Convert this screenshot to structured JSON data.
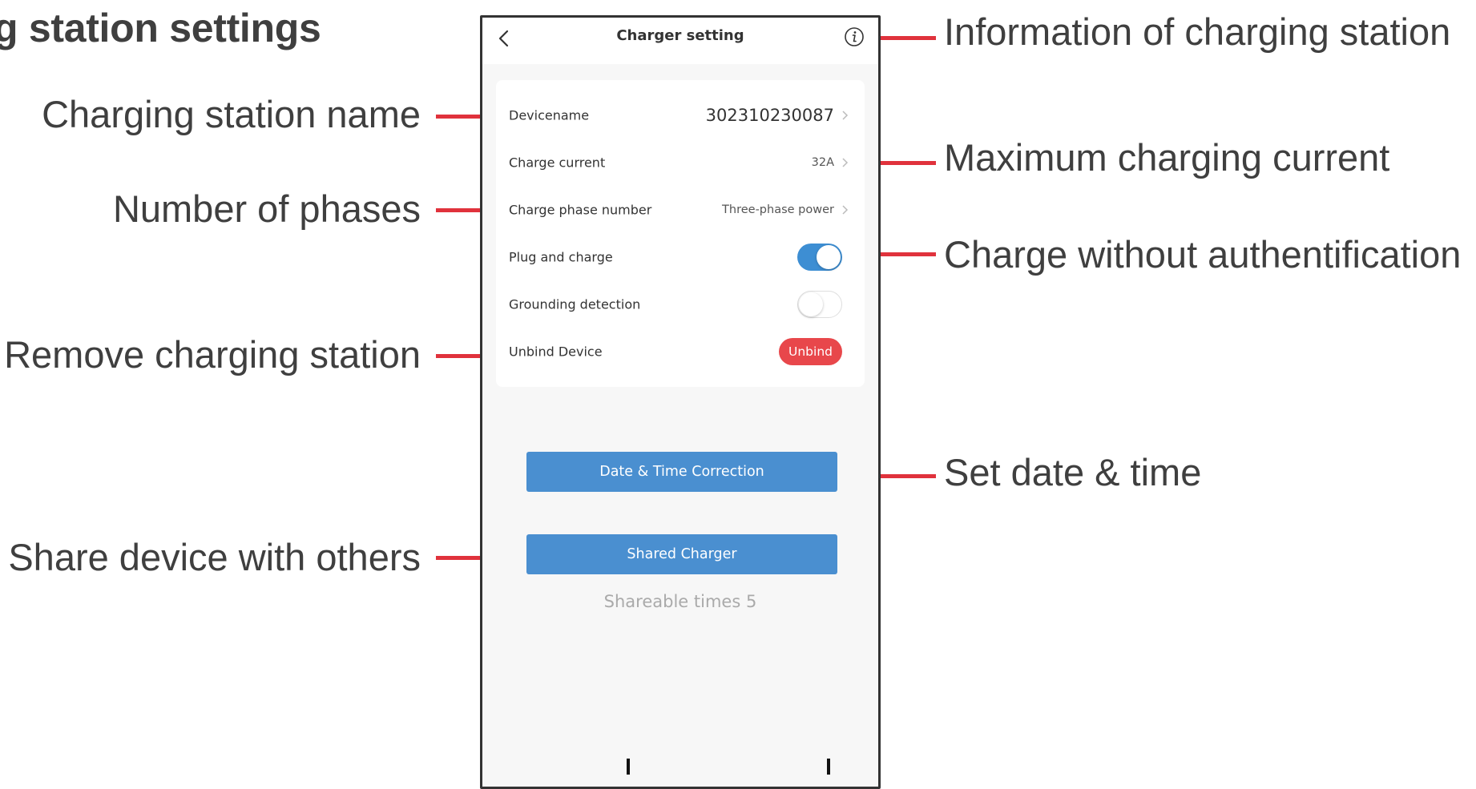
{
  "heading": "g station settings",
  "annotations": {
    "info": "Information of charging station",
    "name": "Charging station name",
    "max_current": "Maximum charging current",
    "phases": "Number of phases",
    "plug_charge": "Charge without authentification",
    "remove": "Remove charging station",
    "datetime": "Set date & time",
    "share": "Share device with others"
  },
  "app": {
    "title": "Charger setting",
    "icons": {
      "back": "chevron-left-icon",
      "info": "info-icon",
      "chevron": "chevron-right-icon"
    },
    "rows": {
      "device_name": {
        "label": "Devicename",
        "value": "302310230087"
      },
      "charge_current": {
        "label": "Charge current",
        "value": "32A"
      },
      "phase_number": {
        "label": "Charge phase number",
        "value": "Three-phase power"
      },
      "plug_and_charge": {
        "label": "Plug and charge",
        "enabled": true
      },
      "grounding": {
        "label": "Grounding detection",
        "enabled": false
      },
      "unbind": {
        "label": "Unbind Device",
        "button": "Unbind"
      }
    },
    "date_time_button": "Date & Time Correction",
    "shared_button": "Shared Charger",
    "shareable_text": "Shareable times 5"
  },
  "colors": {
    "accent": "#4a8fd0",
    "toggle_on": "#3d8ed3",
    "danger": "#e8474b",
    "leader": "#e0323c"
  }
}
